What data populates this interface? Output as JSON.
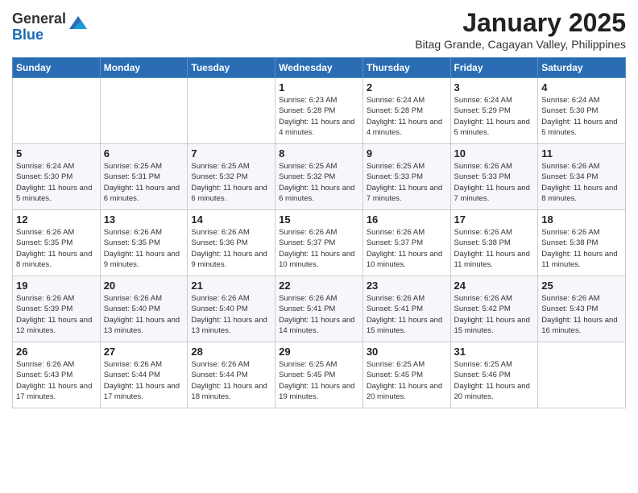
{
  "header": {
    "logo_general": "General",
    "logo_blue": "Blue",
    "month_title": "January 2025",
    "location": "Bitag Grande, Cagayan Valley, Philippines"
  },
  "weekdays": [
    "Sunday",
    "Monday",
    "Tuesday",
    "Wednesday",
    "Thursday",
    "Friday",
    "Saturday"
  ],
  "weeks": [
    [
      {
        "day": "",
        "info": ""
      },
      {
        "day": "",
        "info": ""
      },
      {
        "day": "",
        "info": ""
      },
      {
        "day": "1",
        "info": "Sunrise: 6:23 AM\nSunset: 5:28 PM\nDaylight: 11 hours\nand 4 minutes."
      },
      {
        "day": "2",
        "info": "Sunrise: 6:24 AM\nSunset: 5:28 PM\nDaylight: 11 hours\nand 4 minutes."
      },
      {
        "day": "3",
        "info": "Sunrise: 6:24 AM\nSunset: 5:29 PM\nDaylight: 11 hours\nand 5 minutes."
      },
      {
        "day": "4",
        "info": "Sunrise: 6:24 AM\nSunset: 5:30 PM\nDaylight: 11 hours\nand 5 minutes."
      }
    ],
    [
      {
        "day": "5",
        "info": "Sunrise: 6:24 AM\nSunset: 5:30 PM\nDaylight: 11 hours\nand 5 minutes."
      },
      {
        "day": "6",
        "info": "Sunrise: 6:25 AM\nSunset: 5:31 PM\nDaylight: 11 hours\nand 6 minutes."
      },
      {
        "day": "7",
        "info": "Sunrise: 6:25 AM\nSunset: 5:32 PM\nDaylight: 11 hours\nand 6 minutes."
      },
      {
        "day": "8",
        "info": "Sunrise: 6:25 AM\nSunset: 5:32 PM\nDaylight: 11 hours\nand 6 minutes."
      },
      {
        "day": "9",
        "info": "Sunrise: 6:25 AM\nSunset: 5:33 PM\nDaylight: 11 hours\nand 7 minutes."
      },
      {
        "day": "10",
        "info": "Sunrise: 6:26 AM\nSunset: 5:33 PM\nDaylight: 11 hours\nand 7 minutes."
      },
      {
        "day": "11",
        "info": "Sunrise: 6:26 AM\nSunset: 5:34 PM\nDaylight: 11 hours\nand 8 minutes."
      }
    ],
    [
      {
        "day": "12",
        "info": "Sunrise: 6:26 AM\nSunset: 5:35 PM\nDaylight: 11 hours\nand 8 minutes."
      },
      {
        "day": "13",
        "info": "Sunrise: 6:26 AM\nSunset: 5:35 PM\nDaylight: 11 hours\nand 9 minutes."
      },
      {
        "day": "14",
        "info": "Sunrise: 6:26 AM\nSunset: 5:36 PM\nDaylight: 11 hours\nand 9 minutes."
      },
      {
        "day": "15",
        "info": "Sunrise: 6:26 AM\nSunset: 5:37 PM\nDaylight: 11 hours\nand 10 minutes."
      },
      {
        "day": "16",
        "info": "Sunrise: 6:26 AM\nSunset: 5:37 PM\nDaylight: 11 hours\nand 10 minutes."
      },
      {
        "day": "17",
        "info": "Sunrise: 6:26 AM\nSunset: 5:38 PM\nDaylight: 11 hours\nand 11 minutes."
      },
      {
        "day": "18",
        "info": "Sunrise: 6:26 AM\nSunset: 5:38 PM\nDaylight: 11 hours\nand 11 minutes."
      }
    ],
    [
      {
        "day": "19",
        "info": "Sunrise: 6:26 AM\nSunset: 5:39 PM\nDaylight: 11 hours\nand 12 minutes."
      },
      {
        "day": "20",
        "info": "Sunrise: 6:26 AM\nSunset: 5:40 PM\nDaylight: 11 hours\nand 13 minutes."
      },
      {
        "day": "21",
        "info": "Sunrise: 6:26 AM\nSunset: 5:40 PM\nDaylight: 11 hours\nand 13 minutes."
      },
      {
        "day": "22",
        "info": "Sunrise: 6:26 AM\nSunset: 5:41 PM\nDaylight: 11 hours\nand 14 minutes."
      },
      {
        "day": "23",
        "info": "Sunrise: 6:26 AM\nSunset: 5:41 PM\nDaylight: 11 hours\nand 15 minutes."
      },
      {
        "day": "24",
        "info": "Sunrise: 6:26 AM\nSunset: 5:42 PM\nDaylight: 11 hours\nand 15 minutes."
      },
      {
        "day": "25",
        "info": "Sunrise: 6:26 AM\nSunset: 5:43 PM\nDaylight: 11 hours\nand 16 minutes."
      }
    ],
    [
      {
        "day": "26",
        "info": "Sunrise: 6:26 AM\nSunset: 5:43 PM\nDaylight: 11 hours\nand 17 minutes."
      },
      {
        "day": "27",
        "info": "Sunrise: 6:26 AM\nSunset: 5:44 PM\nDaylight: 11 hours\nand 17 minutes."
      },
      {
        "day": "28",
        "info": "Sunrise: 6:26 AM\nSunset: 5:44 PM\nDaylight: 11 hours\nand 18 minutes."
      },
      {
        "day": "29",
        "info": "Sunrise: 6:25 AM\nSunset: 5:45 PM\nDaylight: 11 hours\nand 19 minutes."
      },
      {
        "day": "30",
        "info": "Sunrise: 6:25 AM\nSunset: 5:45 PM\nDaylight: 11 hours\nand 20 minutes."
      },
      {
        "day": "31",
        "info": "Sunrise: 6:25 AM\nSunset: 5:46 PM\nDaylight: 11 hours\nand 20 minutes."
      },
      {
        "day": "",
        "info": ""
      }
    ]
  ]
}
